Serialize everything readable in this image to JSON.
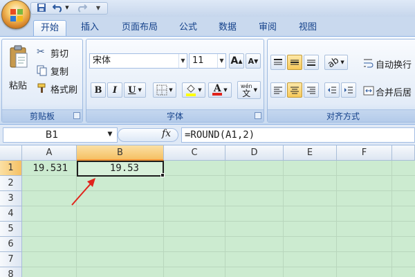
{
  "tabs": [
    "开始",
    "插入",
    "页面布局",
    "公式",
    "数据",
    "审阅",
    "视图"
  ],
  "ribbon": {
    "clipboard": {
      "label": "剪贴板",
      "paste": "粘贴",
      "cut": "剪切",
      "copy": "复制",
      "format_painter": "格式刷"
    },
    "font": {
      "label": "字体",
      "font_name": "宋体",
      "font_size": "11",
      "bold": "B",
      "italic": "I",
      "underline": "U",
      "font_color_glyph": "A",
      "phonetic_top": "wén",
      "phonetic_bottom": "文",
      "grow_glyph": "A",
      "shrink_glyph": "A"
    },
    "alignment": {
      "label": "对齐方式",
      "wrap_text": "自动换行",
      "merge_center": "合并后居"
    }
  },
  "formula_bar": {
    "name_box": "B1",
    "fx": "fx",
    "formula": "=ROUND(A1,2)"
  },
  "grid": {
    "columns": [
      "A",
      "B",
      "C",
      "D",
      "E",
      "F"
    ],
    "rows": [
      "1",
      "2",
      "3",
      "4",
      "5",
      "6",
      "7",
      "8"
    ],
    "cells": {
      "A1": "19.531",
      "B1": "19.53"
    },
    "selected_cell": "B1"
  },
  "colors": {
    "selection": "#f5c064",
    "grid_bg": "#ccebd0",
    "arrow": "#e0241c",
    "ribbon_text": "#15428b"
  }
}
